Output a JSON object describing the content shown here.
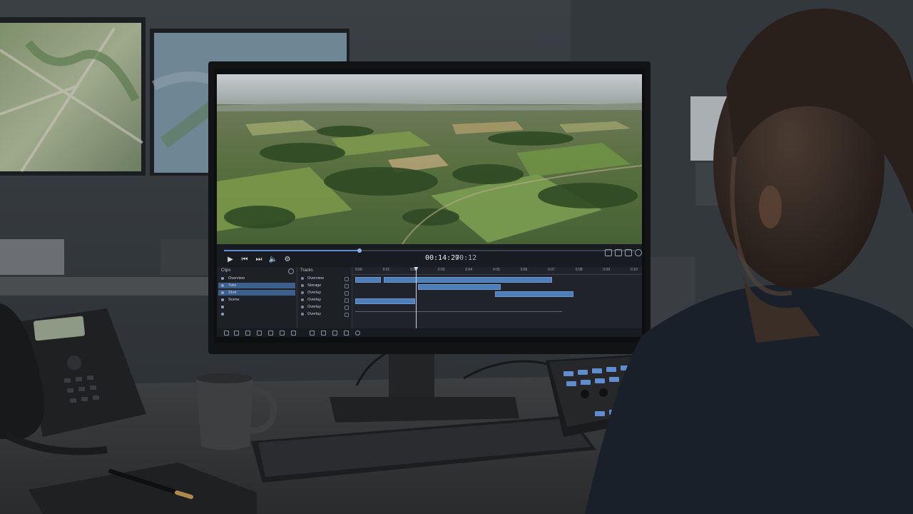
{
  "player": {
    "current_time": "00:14:27",
    "duration": "00:12",
    "source_label": "",
    "progress": 0.33
  },
  "clips_panel": {
    "title": "Clips",
    "items": [
      {
        "label": "Overview",
        "selected": false
      },
      {
        "label": "Take",
        "selected": true
      },
      {
        "label": "Shot",
        "selected": true
      },
      {
        "label": "Scene",
        "selected": false
      }
    ]
  },
  "tracks_panel": {
    "title": "Tracks",
    "items": [
      {
        "label": "Overview"
      },
      {
        "label": "Storage"
      },
      {
        "label": "Overlay"
      },
      {
        "label": "Overlay"
      },
      {
        "label": "Overlay"
      },
      {
        "label": "Overlay"
      }
    ]
  },
  "timeline": {
    "ruler_labels": [
      "0:00",
      "0:01",
      "0:02",
      "0:03",
      "0:04",
      "0:05",
      "0:06",
      "0:07",
      "0:08",
      "0:09",
      "0:10"
    ],
    "playhead": 0.22
  },
  "colors": {
    "accent": "#4f7fb9",
    "screen_bg": "#1b1e22",
    "panel_bg": "#1d2126",
    "selection": "#3d5f8c"
  },
  "icons": {
    "transport": [
      "play-icon",
      "skip-back-icon",
      "skip-forward-icon",
      "volume-icon",
      "settings-icon"
    ],
    "right_tools": [
      "fullscreen-icon",
      "snapshot-icon",
      "layout-icon",
      "gear-icon"
    ]
  }
}
